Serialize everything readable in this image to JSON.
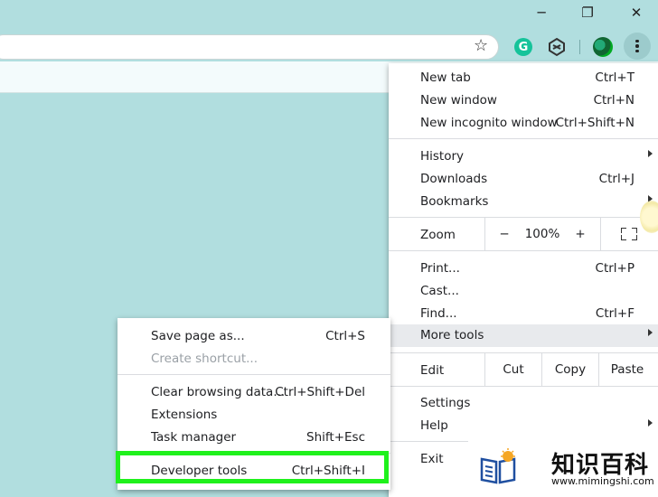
{
  "window_controls": {
    "minimize": "─",
    "restore": "❐",
    "close": "✕"
  },
  "main_menu": {
    "new_tab": {
      "label": "New tab",
      "shortcut": "Ctrl+T"
    },
    "new_window": {
      "label": "New window",
      "shortcut": "Ctrl+N"
    },
    "new_incognito": {
      "label": "New incognito window",
      "shortcut": "Ctrl+Shift+N"
    },
    "history": {
      "label": "History"
    },
    "downloads": {
      "label": "Downloads",
      "shortcut": "Ctrl+J"
    },
    "bookmarks": {
      "label": "Bookmarks"
    },
    "zoom": {
      "label": "Zoom",
      "minus": "−",
      "value": "100%",
      "plus": "+"
    },
    "print": {
      "label": "Print...",
      "shortcut": "Ctrl+P"
    },
    "cast": {
      "label": "Cast..."
    },
    "find": {
      "label": "Find...",
      "shortcut": "Ctrl+F"
    },
    "more_tools": {
      "label": "More tools"
    },
    "edit": {
      "label": "Edit",
      "cut": "Cut",
      "copy": "Copy",
      "paste": "Paste"
    },
    "settings": {
      "label": "Settings"
    },
    "help": {
      "label": "Help"
    },
    "exit": {
      "label": "Exit"
    }
  },
  "more_tools_menu": {
    "save_page": {
      "label": "Save page as...",
      "shortcut": "Ctrl+S"
    },
    "create_shortcut": {
      "label": "Create shortcut..."
    },
    "clear_data": {
      "label": "Clear browsing data...",
      "shortcut": "Ctrl+Shift+Del"
    },
    "extensions": {
      "label": "Extensions"
    },
    "task_manager": {
      "label": "Task manager",
      "shortcut": "Shift+Esc"
    },
    "developer_tools": {
      "label": "Developer tools",
      "shortcut": "Ctrl+Shift+I"
    }
  },
  "watermark": {
    "cn": "知识百科",
    "url": "www.mimingshi.com"
  },
  "colors": {
    "page_bg": "#b1dedf",
    "highlight": "#1ff11c",
    "grammarly": "#15c39a"
  }
}
